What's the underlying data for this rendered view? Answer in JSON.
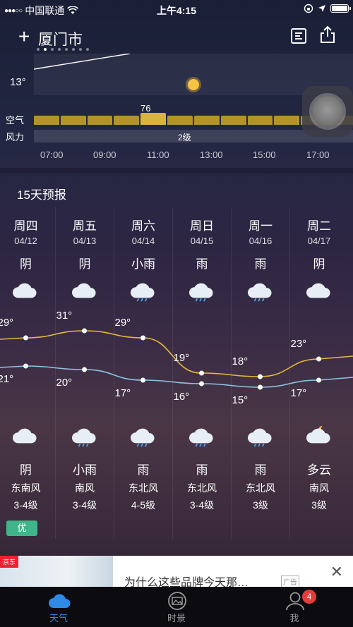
{
  "status_bar": {
    "carrier": "中国联通",
    "time": "上午4:15"
  },
  "header": {
    "city": "厦门市",
    "page_count": 8,
    "active_page": 1
  },
  "hourly": {
    "current_temp": "13°",
    "aq_label": "空气",
    "wind_label": "风力",
    "aq_value": "76",
    "wind_value": "2级",
    "hours": [
      "07:00",
      "09:00",
      "11:00",
      "13:00",
      "15:00",
      "17:00"
    ]
  },
  "forecast": {
    "title": "15天预报",
    "days": [
      {
        "dow": "周四",
        "date": "04/12",
        "day_cond": "阴",
        "day_icon": "cloud-icon",
        "high": "29°",
        "low": "21°",
        "night_icon": "cloud-icon",
        "night_cond": "阴",
        "wind_dir": "东南风",
        "wind_lvl": "3-4级",
        "aq": "优"
      },
      {
        "dow": "周五",
        "date": "04/13",
        "day_cond": "阴",
        "day_icon": "cloud-icon",
        "high": "31°",
        "low": "20°",
        "night_icon": "rain-cloud-icon",
        "night_cond": "小雨",
        "wind_dir": "南风",
        "wind_lvl": "3-4级",
        "aq": ""
      },
      {
        "dow": "周六",
        "date": "04/14",
        "day_cond": "小雨",
        "day_icon": "rain-cloud-icon",
        "high": "29°",
        "low": "17°",
        "night_icon": "rain-cloud-icon",
        "night_cond": "雨",
        "wind_dir": "东北风",
        "wind_lvl": "4-5级",
        "aq": ""
      },
      {
        "dow": "周日",
        "date": "04/15",
        "day_cond": "雨",
        "day_icon": "rain-cloud-icon",
        "high": "19°",
        "low": "16°",
        "night_icon": "rain-cloud-icon",
        "night_cond": "雨",
        "wind_dir": "东北风",
        "wind_lvl": "3-4级",
        "aq": ""
      },
      {
        "dow": "周一",
        "date": "04/16",
        "day_cond": "雨",
        "day_icon": "rain-cloud-icon",
        "high": "18°",
        "low": "15°",
        "night_icon": "rain-cloud-icon",
        "night_cond": "雨",
        "wind_dir": "东北风",
        "wind_lvl": "3级",
        "aq": ""
      },
      {
        "dow": "周二",
        "date": "04/17",
        "day_cond": "阴",
        "day_icon": "cloud-icon",
        "high": "23°",
        "low": "17°",
        "night_icon": "moon-cloud-icon",
        "night_cond": "多云",
        "wind_dir": "南风",
        "wind_lvl": "3级",
        "aq": ""
      }
    ],
    "high_values": [
      29,
      31,
      29,
      19,
      18,
      23
    ],
    "low_values": [
      21,
      20,
      17,
      16,
      15,
      17
    ],
    "colors": {
      "high_line": "#e6b93a",
      "low_line": "#8fc3e6",
      "aq_good": "#3fb58a"
    }
  },
  "ad": {
    "brand": "京东",
    "text": "为什么这些品牌今天那…",
    "tag": "广告"
  },
  "tabbar": {
    "tabs": [
      {
        "label": "天气",
        "active": true
      },
      {
        "label": "时景",
        "active": false
      },
      {
        "label": "我",
        "active": false,
        "badge": "4"
      }
    ]
  }
}
